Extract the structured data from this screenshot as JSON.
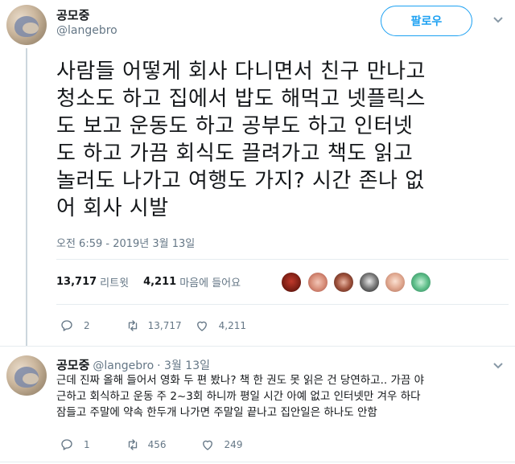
{
  "tweet": {
    "author_name": "공모중",
    "author_handle": "@langebro",
    "follow_label": "팔로우",
    "lines": [
      "사람들 어떻게 회사 다니면서 친구 만나고",
      "청소도 하고 집에서 밥도 해먹고 넷플릭스",
      "도 보고 운동도 하고 공부도 하고 인터넷",
      "도 하고 가끔 회식도 끌려가고 책도 읽고",
      "놀러도 나가고 여행도 가지? 시간 존나 없",
      "어 회사 시발"
    ],
    "timestamp": "오전 6:59 - 2019년 3월 13일",
    "retweets_count": "13,717",
    "retweets_label": "리트윗",
    "likes_count": "4,211",
    "likes_label": "마음에 들어요",
    "actions": {
      "replies": "2",
      "retweets": "13,717",
      "likes": "4,211"
    }
  },
  "reply": {
    "author_name": "공모중",
    "author_handle": "@langebro",
    "date": "· 3월 13일",
    "lines": [
      "근데 진짜 올해 들어서 영화 두 편 봤나? 책 한 권도 못 읽은 건 당연하고.. 가끔 야",
      "근하고 회식하고 운동 주 2~3회 하니까 평일 시간 아예 없고 인터넷만 겨우 하다",
      "잠들고 주말에 약속 한두개 나가면 주말일 끝나고 집안일은 하나도 안함"
    ],
    "actions": {
      "replies": "1",
      "retweets": "456",
      "likes": "249"
    }
  },
  "colors": {
    "accent": "#1da1f2",
    "muted": "#657786",
    "text": "#14171a",
    "divider": "#e6ecf0"
  }
}
